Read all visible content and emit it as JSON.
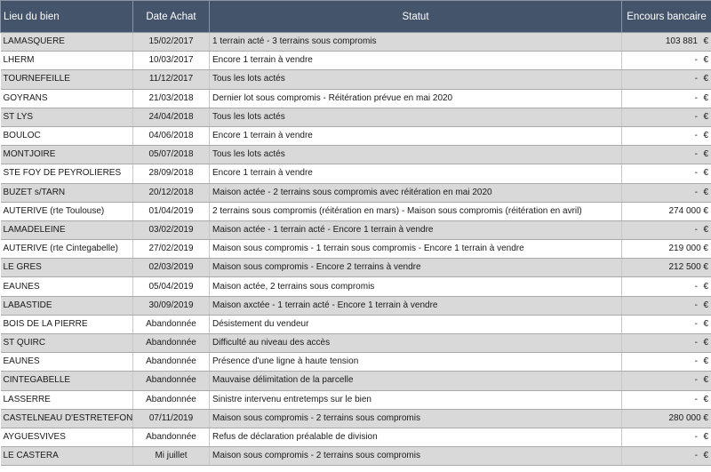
{
  "headers": [
    "Lieu du bien",
    "Date Achat",
    "Statut",
    "Encours bancaire"
  ],
  "rows": [
    {
      "lieu": "LAMASQUERE",
      "date": "15/02/2017",
      "statut": "1 terrain acté - 3 terrains sous compromis",
      "encours": "103 881",
      "cur": "€"
    },
    {
      "lieu": "LHERM",
      "date": "10/03/2017",
      "statut": "Encore 1 terrain à vendre",
      "encours": "-",
      "cur": "€"
    },
    {
      "lieu": "TOURNEFEILLE",
      "date": "11/12/2017",
      "statut": "Tous les lots actés",
      "encours": "-",
      "cur": "€"
    },
    {
      "lieu": "GOYRANS",
      "date": "21/03/2018",
      "statut": "Dernier lot sous compromis - Réitération prévue en mai 2020",
      "encours": "-",
      "cur": "€"
    },
    {
      "lieu": "ST LYS",
      "date": "24/04/2018",
      "statut": "Tous les lots actés",
      "encours": "-",
      "cur": "€"
    },
    {
      "lieu": "BOULOC",
      "date": "04/06/2018",
      "statut": "Encore 1 terrain à vendre",
      "encours": "-",
      "cur": "€"
    },
    {
      "lieu": "MONTJOIRE",
      "date": "05/07/2018",
      "statut": "Tous les lots actés",
      "encours": "-",
      "cur": "€"
    },
    {
      "lieu": "STE FOY DE PEYROLIERES",
      "date": "28/09/2018",
      "statut": "Encore 1 terrain à vendre",
      "encours": "-",
      "cur": "€"
    },
    {
      "lieu": "BUZET s/TARN",
      "date": "20/12/2018",
      "statut": "Maison actée - 2 terrains sous compromis avec réitération en mai 2020",
      "encours": "-",
      "cur": "€"
    },
    {
      "lieu": "AUTERIVE (rte Toulouse)",
      "date": "01/04/2019",
      "statut": "2 terrains sous compromis (réitération en mars) - Maison sous compromis (réitération en avril)",
      "encours": "274 000 €",
      "cur": ""
    },
    {
      "lieu": "LAMADELEINE",
      "date": "03/02/2019",
      "statut": "Maison actée - 1 terrain acté - Encore 1 terrain à vendre",
      "encours": "-",
      "cur": "€"
    },
    {
      "lieu": "AUTERIVE (rte Cintegabelle)",
      "date": "27/02/2019",
      "statut": "Maison sous compromis - 1 terrain sous compromis - Encore 1 terrain à vendre",
      "encours": "219 000 €",
      "cur": ""
    },
    {
      "lieu": "LE GRES",
      "date": "02/03/2019",
      "statut": "Maison sous compromis - Encore 2 terrains à vendre",
      "encours": "212 500 €",
      "cur": ""
    },
    {
      "lieu": "EAUNES",
      "date": "05/04/2019",
      "statut": "Maison actée, 2 terrains sous compromis",
      "encours": "-",
      "cur": "€"
    },
    {
      "lieu": "LABASTIDE",
      "date": "30/09/2019",
      "statut": "Maison axctée - 1 terrain acté - Encore 1 terrain à vendre",
      "encours": "-",
      "cur": "€"
    },
    {
      "lieu": "BOIS DE LA PIERRE",
      "date": "Abandonnée",
      "statut": "Désistement du vendeur",
      "encours": "-",
      "cur": "€"
    },
    {
      "lieu": "ST QUIRC",
      "date": "Abandonnée",
      "statut": "Difficulté au niveau des accès",
      "encours": "-",
      "cur": "€"
    },
    {
      "lieu": "EAUNES",
      "date": "Abandonnée",
      "statut": "Présence d'une ligne à haute tension",
      "encours": "-",
      "cur": "€"
    },
    {
      "lieu": "CINTEGABELLE",
      "date": "Abandonnée",
      "statut": "Mauvaise délimitation de la parcelle",
      "encours": "-",
      "cur": "€"
    },
    {
      "lieu": "LASSERRE",
      "date": "Abandonnée",
      "statut": "Sinistre intervenu entretemps sur le bien",
      "encours": "-",
      "cur": "€"
    },
    {
      "lieu": "CASTELNEAU D'ESTRETEFONDS",
      "date": "07/11/2019",
      "statut": "Maison sous compromis - 2 terrains sous compromis",
      "encours": "280 000 €",
      "cur": ""
    },
    {
      "lieu": "AYGUESVIVES",
      "date": "Abandonnée",
      "statut": "Refus de déclaration préalable de division",
      "encours": "-",
      "cur": "€"
    },
    {
      "lieu": "LE CASTERA",
      "date": "Mi juillet",
      "statut": "Maison sous compromis - 2 terrains sous compromis",
      "encours": "-",
      "cur": "€"
    }
  ]
}
